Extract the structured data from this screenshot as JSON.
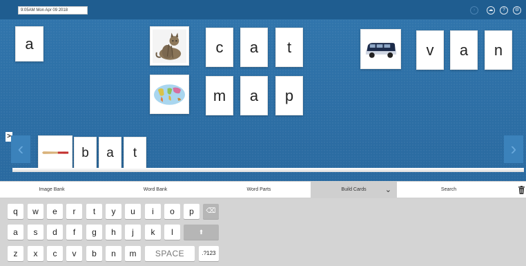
{
  "header": {
    "datetime": "9:05AM Mon Apr 09 2018",
    "icons": [
      "forward-icon",
      "cloud-icon",
      "help-icon",
      "settings-icon"
    ],
    "bar_color": "#1f5d90"
  },
  "board": {
    "background_color": "#2b6ea4",
    "standalone_letter": "a",
    "cat_word": {
      "picture": "cat-photo",
      "letters": [
        "c",
        "a",
        "t"
      ]
    },
    "map_word": {
      "picture": "world-map",
      "letters": [
        "m",
        "a",
        "p"
      ]
    },
    "van_word": {
      "picture": "van-photo",
      "letters": [
        "v",
        "a",
        "n"
      ]
    },
    "tray_word": {
      "picture": "baseball-bat",
      "letters": [
        "b",
        "a",
        "t"
      ]
    },
    "expand_symbol": ">",
    "left_arrow": "‹",
    "right_arrow": "›"
  },
  "tabs": {
    "items": [
      "Image Bank",
      "Word Bank",
      "Word Parts",
      "Build Cards",
      "Search"
    ],
    "active": "Build Cards",
    "chevron": "❯"
  },
  "keyboard": {
    "row1": [
      "q",
      "w",
      "e",
      "r",
      "t",
      "y",
      "u",
      "i",
      "o",
      "p"
    ],
    "row2": [
      "a",
      "s",
      "d",
      "f",
      "g",
      "h",
      "j",
      "k",
      "l"
    ],
    "row3": [
      "z",
      "x",
      "c",
      "v",
      "b",
      "n",
      "m"
    ],
    "backspace_icon": "⌫",
    "shift_icon": "⬆",
    "space_label": "SPACE",
    "numbers_label": ".?123"
  }
}
